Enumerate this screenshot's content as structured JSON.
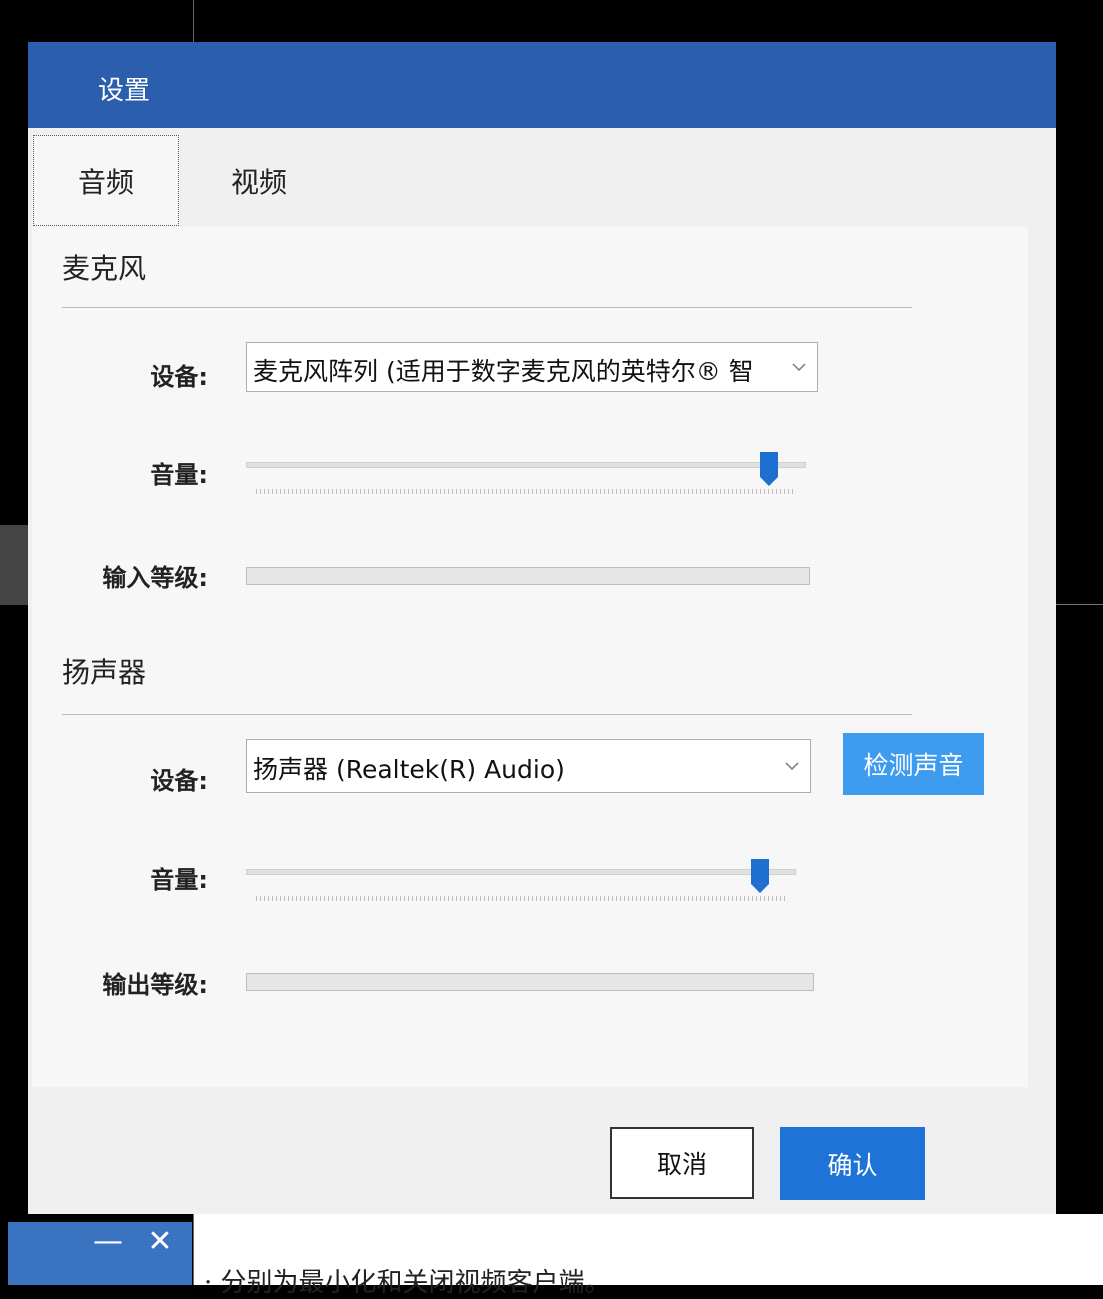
{
  "dialog": {
    "title": "设置",
    "tabs": [
      {
        "label": "音频",
        "active": true
      },
      {
        "label": "视频",
        "active": false
      }
    ]
  },
  "microphone": {
    "section_title": "麦克风",
    "device_label": "设备:",
    "device_value": "麦克风阵列 (适用于数字麦克风的英特尔® 智",
    "volume_label": "音量:",
    "volume_level": 0.95,
    "input_level_label": "输入等级:",
    "input_level": 0
  },
  "speaker": {
    "section_title": "扬声器",
    "device_label": "设备:",
    "device_value": "扬声器 (Realtek(R) Audio)",
    "test_button": "检测声音",
    "volume_label": "音量:",
    "volume_level": 0.95,
    "output_level_label": "输出等级:",
    "output_level": 0
  },
  "footer": {
    "cancel_label": "取消",
    "confirm_label": "确认"
  },
  "client_controls": {
    "minimize_icon": "minimize-icon",
    "close_icon": "close-icon",
    "minimize_glyph": "—",
    "close_glyph": "✕"
  },
  "caption": "·  分别为最小化和关闭视频客户端。",
  "colors": {
    "titlebar": "#2b5ead",
    "accent": "#1e74d6",
    "test_button": "#3d9bf0",
    "slider_thumb": "#1e6fd0"
  }
}
